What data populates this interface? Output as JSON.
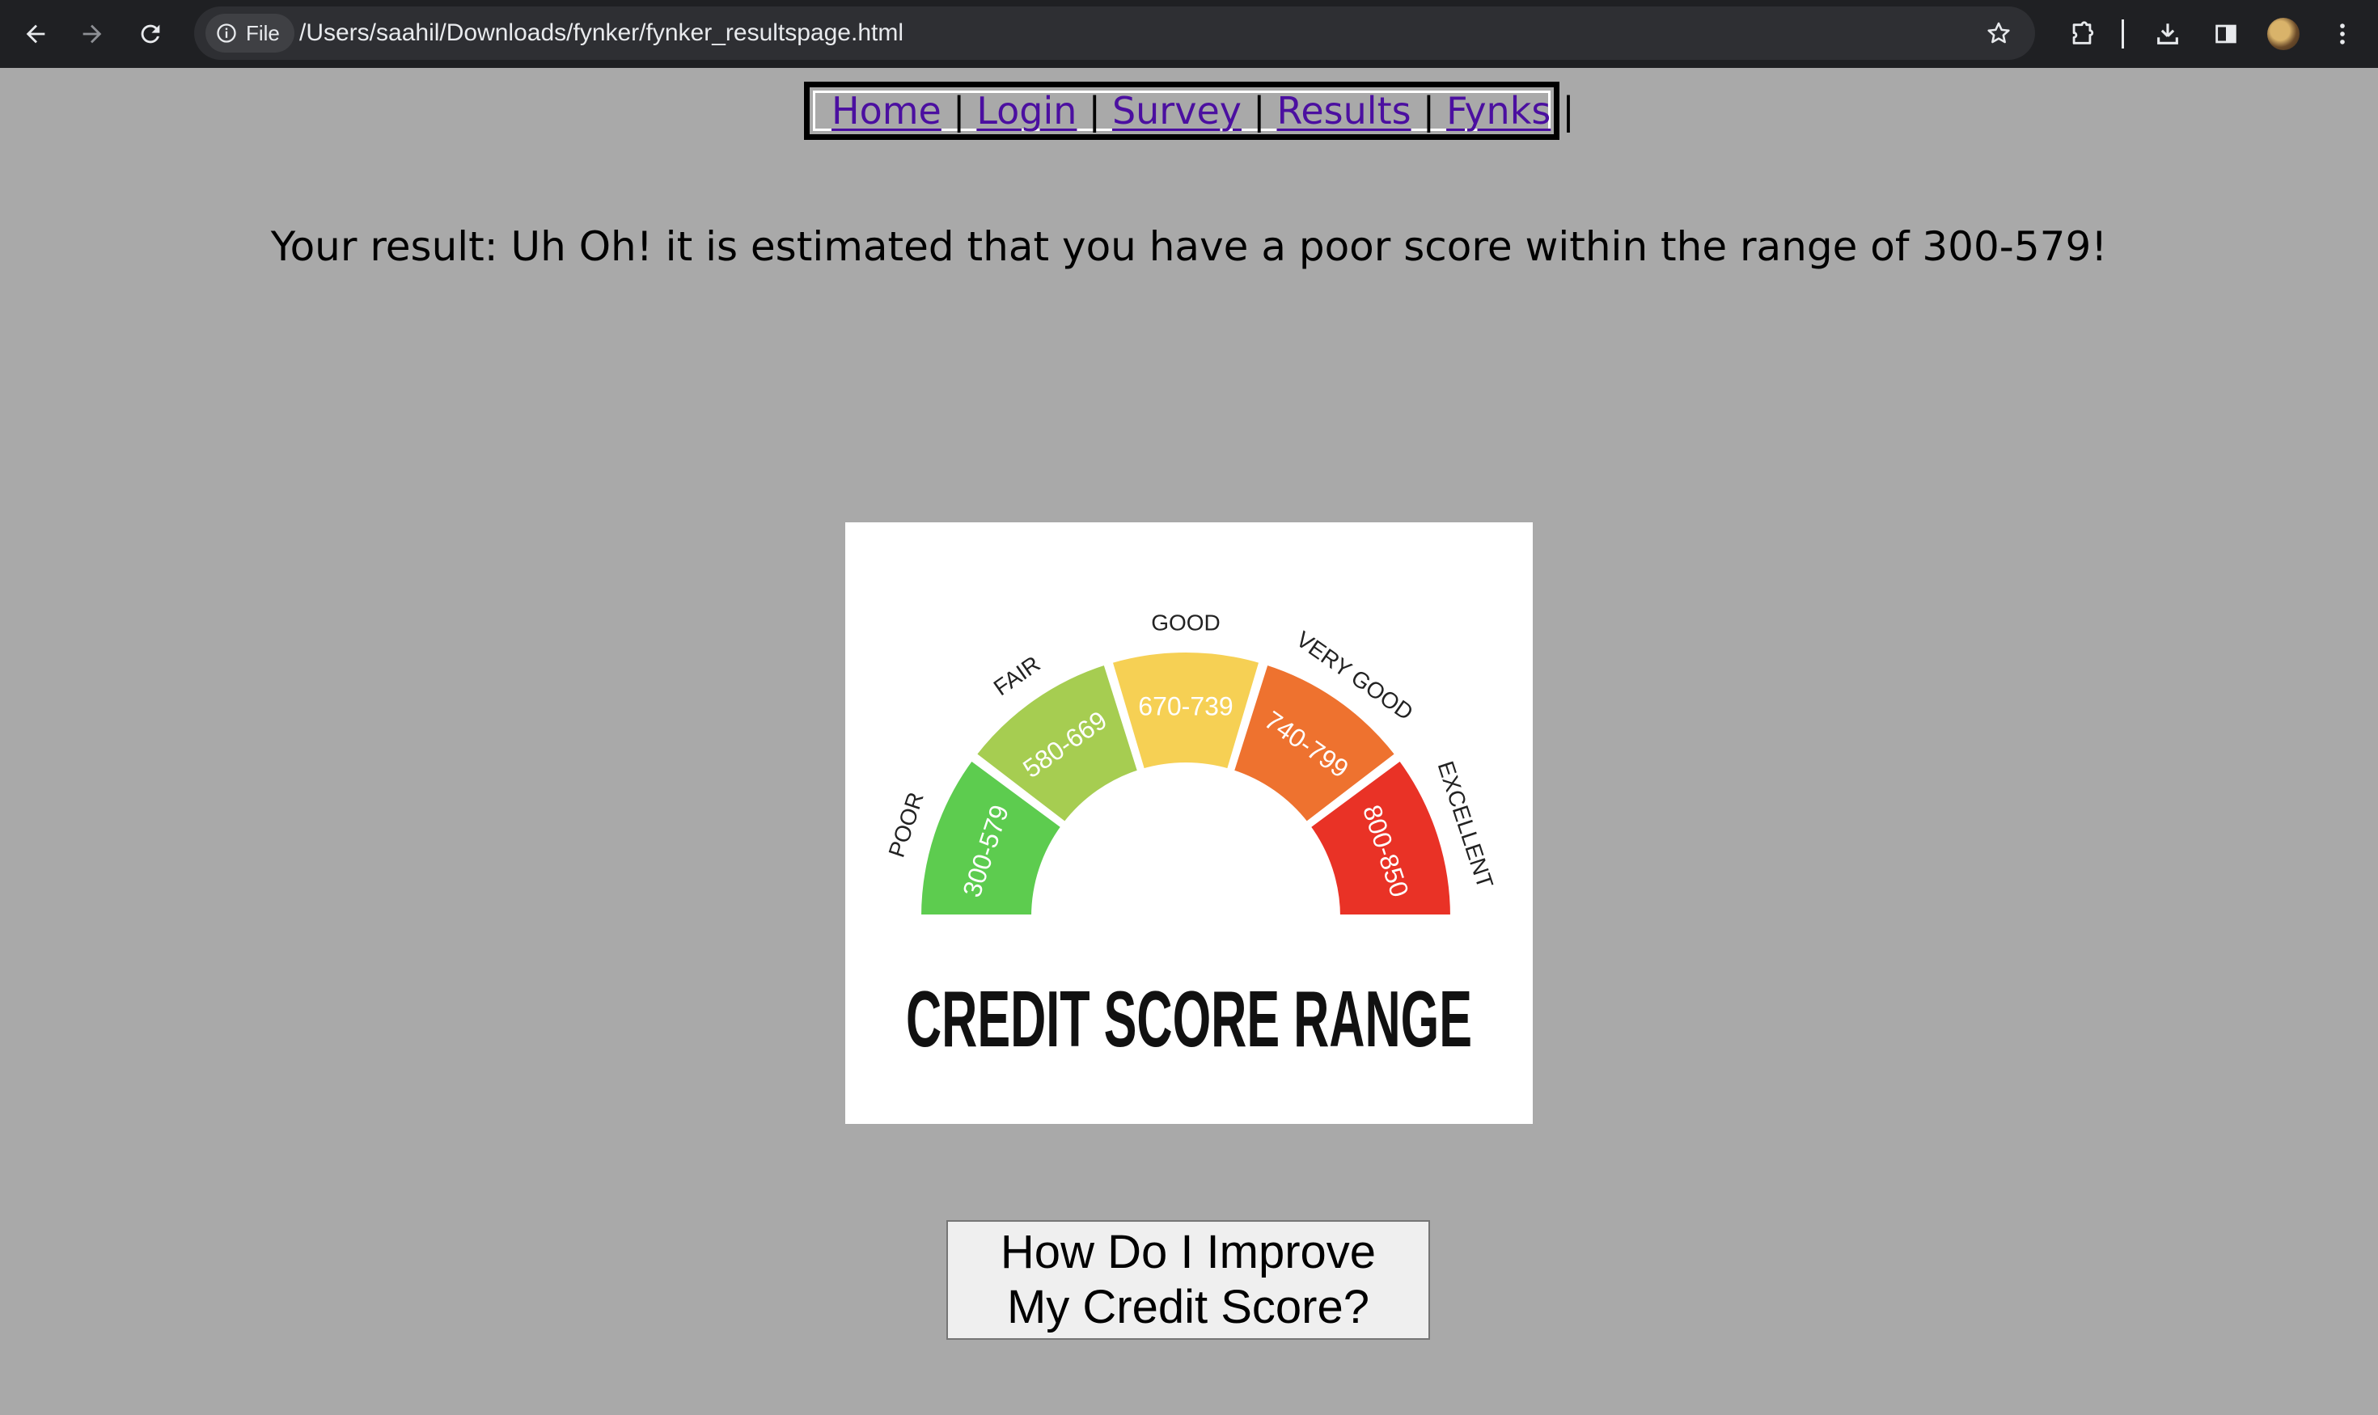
{
  "browser": {
    "file_chip_label": "File",
    "url": "/Users/saahil/Downloads/fynker/fynker_resultspage.html"
  },
  "nav": {
    "links": [
      "Home",
      "Login",
      "Survey",
      "Results",
      "Fynks"
    ],
    "separator": "|"
  },
  "result_text": "Your result: Uh Oh! it is estimated that you have a poor score within the range of 300-579!",
  "gauge": {
    "title": "CREDIT SCORE RANGE",
    "segments": [
      {
        "label": "POOR",
        "range": "300-579",
        "color": "#5dcc4f"
      },
      {
        "label": "FAIR",
        "range": "580-669",
        "color": "#a6cd51"
      },
      {
        "label": "GOOD",
        "range": "670-739",
        "color": "#f6d054"
      },
      {
        "label": "VERY GOOD",
        "range": "740-799",
        "color": "#ee722f"
      },
      {
        "label": "EXCELLENT",
        "range": "800-850",
        "color": "#e93226"
      }
    ]
  },
  "improve_button": {
    "line1": "How Do I Improve",
    "line2": "My Credit Score?"
  }
}
